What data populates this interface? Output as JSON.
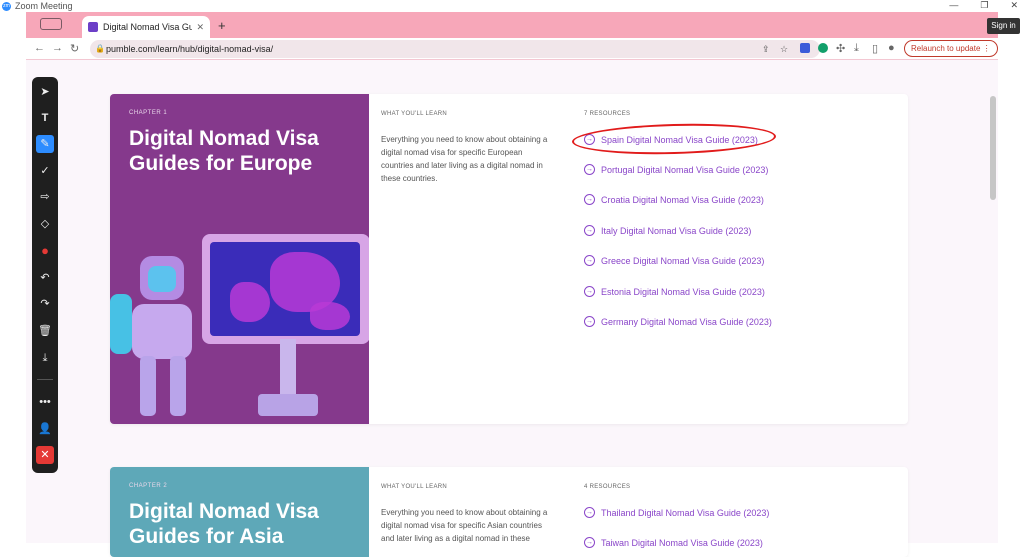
{
  "zoom": {
    "title": "Zoom Meeting",
    "logo": "zm",
    "sign_in": "Sign in"
  },
  "browser": {
    "tab_title": "Digital Nomad Visa Guides – P",
    "url": "pumble.com/learn/hub/digital-nomad-visa/",
    "relaunch_label": "Relaunch to update"
  },
  "card1": {
    "chapter": "CHAPTER 1",
    "title": "Digital Nomad Visa Guides for Europe",
    "learn_heading": "WHAT YOU'LL LEARN",
    "learn_text": "Everything you need to know about obtaining a digital nomad visa for specific European countries and later living as a digital nomad in these countries.",
    "resources_heading": "7 RESOURCES",
    "resources": [
      "Spain Digital Nomad Visa Guide (2023)",
      "Portugal Digital Nomad Visa Guide (2023)",
      "Croatia Digital Nomad Visa Guide (2023)",
      "Italy Digital Nomad Visa Guide (2023)",
      "Greece Digital Nomad Visa Guide (2023)",
      "Estonia Digital Nomad Visa Guide (2023)",
      "Germany Digital Nomad Visa Guide (2023)"
    ]
  },
  "card2": {
    "chapter": "CHAPTER 2",
    "title": "Digital Nomad Visa Guides for Asia",
    "learn_heading": "WHAT YOU'LL LEARN",
    "learn_text": "Everything you need to know about obtaining a digital nomad visa for specific Asian countries and later living as a digital nomad in these",
    "resources_heading": "4 RESOURCES",
    "resources": [
      "Thailand Digital Nomad Visa Guide (2023)",
      "Taiwan Digital Nomad Visa Guide (2023)"
    ]
  },
  "colors": {
    "accent": "#8a46c9",
    "chapter1": "#85398c",
    "chapter2": "#5ea8b8",
    "annotation": "#e11b1b",
    "chrome": "#f7a7b9"
  },
  "toolbar": {
    "tools": [
      "pointer-icon",
      "text-icon",
      "pen-icon",
      "checkmark-icon",
      "arrow-icon",
      "eraser-icon",
      "color-icon",
      "undo-icon",
      "redo-icon",
      "trash-icon",
      "save-icon",
      "more-icon",
      "participant-icon",
      "close-icon"
    ]
  }
}
